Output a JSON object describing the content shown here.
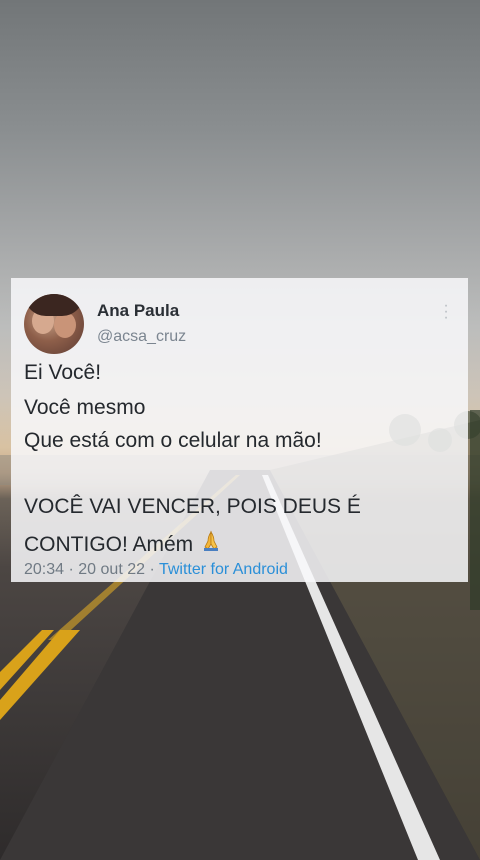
{
  "tweet": {
    "author_name": "Ana Paula",
    "author_handle": "@acsa_cruz",
    "lines": [
      "Ei Você!",
      "Você mesmo",
      "Que está com o celular na mão!",
      "VOCÊ VAI VENCER, POIS DEUS É",
      "CONTIGO!  Amém"
    ],
    "emoji_icon": "praying-hands-icon",
    "time": "20:34",
    "date": "20 out 22",
    "separator": "·",
    "source": "Twitter for Android"
  },
  "colors": {
    "card_bg": "#f8f8fa",
    "name": "#2a2f35",
    "meta": "#707a84",
    "link": "#2a8fd8",
    "road_line": "#e6e6e6",
    "center_line": "#d9a21a"
  },
  "icons": [
    "more-icon",
    "avatar",
    "praying-hands-icon"
  ]
}
